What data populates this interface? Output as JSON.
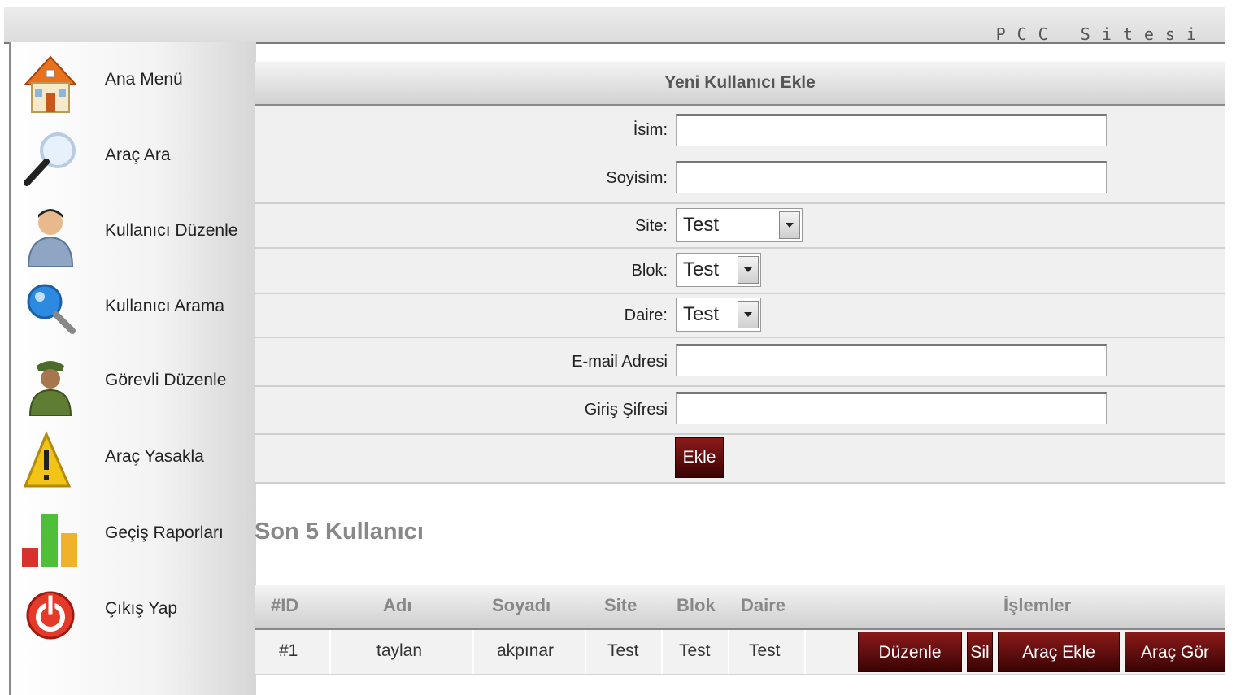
{
  "site_title": "PCC Sitesi",
  "sidebar": {
    "items": [
      {
        "label": "Ana Menü",
        "icon": "home-icon"
      },
      {
        "label": "Araç Ara",
        "icon": "magnifier-icon"
      },
      {
        "label": "Kullanıcı Düzenle",
        "icon": "user-icon"
      },
      {
        "label": "Kullanıcı Arama",
        "icon": "user-search-icon"
      },
      {
        "label": "Görevli Düzenle",
        "icon": "officer-icon"
      },
      {
        "label": "Araç Yasakla",
        "icon": "warning-icon"
      },
      {
        "label": "Geçiş Raporları",
        "icon": "bar-chart-icon"
      },
      {
        "label": "Çıkış Yap",
        "icon": "power-icon"
      }
    ]
  },
  "form": {
    "title": "Yeni Kullanıcı Ekle",
    "name_label": "İsim:",
    "name_value": "",
    "surname_label": "Soyisim:",
    "surname_value": "",
    "site_label": "Site:",
    "site_value": "Test",
    "block_label": "Blok:",
    "block_value": "Test",
    "apartment_label": "Daire:",
    "apartment_value": "Test",
    "email_label": "E-mail Adresi",
    "email_value": "",
    "password_label": "Giriş Şifresi",
    "password_value": "",
    "submit_label": "Ekle"
  },
  "recent_users": {
    "title": "Son 5 Kullanıcı",
    "columns": [
      "#ID",
      "Adı",
      "Soyadı",
      "Site",
      "Blok",
      "Daire",
      "İşlemler"
    ],
    "rows": [
      {
        "id": "#1",
        "first_name": "taylan",
        "last_name": "akpınar",
        "site": "Test",
        "block": "Test",
        "apartment": "Test"
      }
    ],
    "actions": {
      "edit": "Düzenle",
      "delete": "Sil",
      "add_vehicle": "Araç Ekle",
      "view_vehicle": "Araç Gör"
    }
  },
  "colors": {
    "action_button": "#6b0f0f",
    "header_gray": "#d2d2d2"
  }
}
